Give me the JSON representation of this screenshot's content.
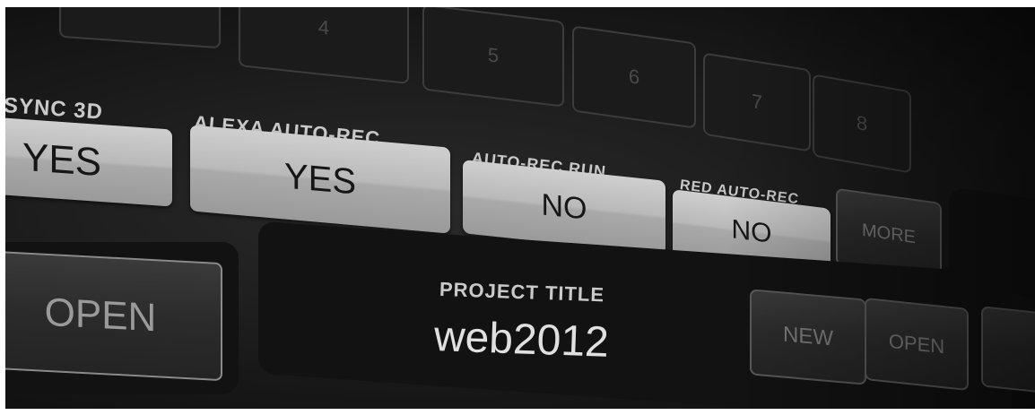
{
  "camera_slots": [
    "4",
    "5",
    "6",
    "7",
    "8"
  ],
  "sync3d": {
    "label": "SYNC 3D",
    "value": "YES"
  },
  "alexa_auto_rec": {
    "label": "ALEXA AUTO-REC",
    "value": "YES"
  },
  "auto_rec_run": {
    "label": "AUTO-REC RUN",
    "value": "NO"
  },
  "red_auto_rec": {
    "label": "RED AUTO-REC",
    "value": "NO"
  },
  "more_button": "MORE",
  "open_button": "OPEN",
  "project": {
    "label": "PROJECT TITLE",
    "title": "web2012",
    "new_button": "NEW",
    "open_button": "OPEN"
  },
  "colors": {
    "background": "#1a1a1a",
    "toggle_fill": "#bdbdbd",
    "label_text": "#c9c9c9"
  }
}
